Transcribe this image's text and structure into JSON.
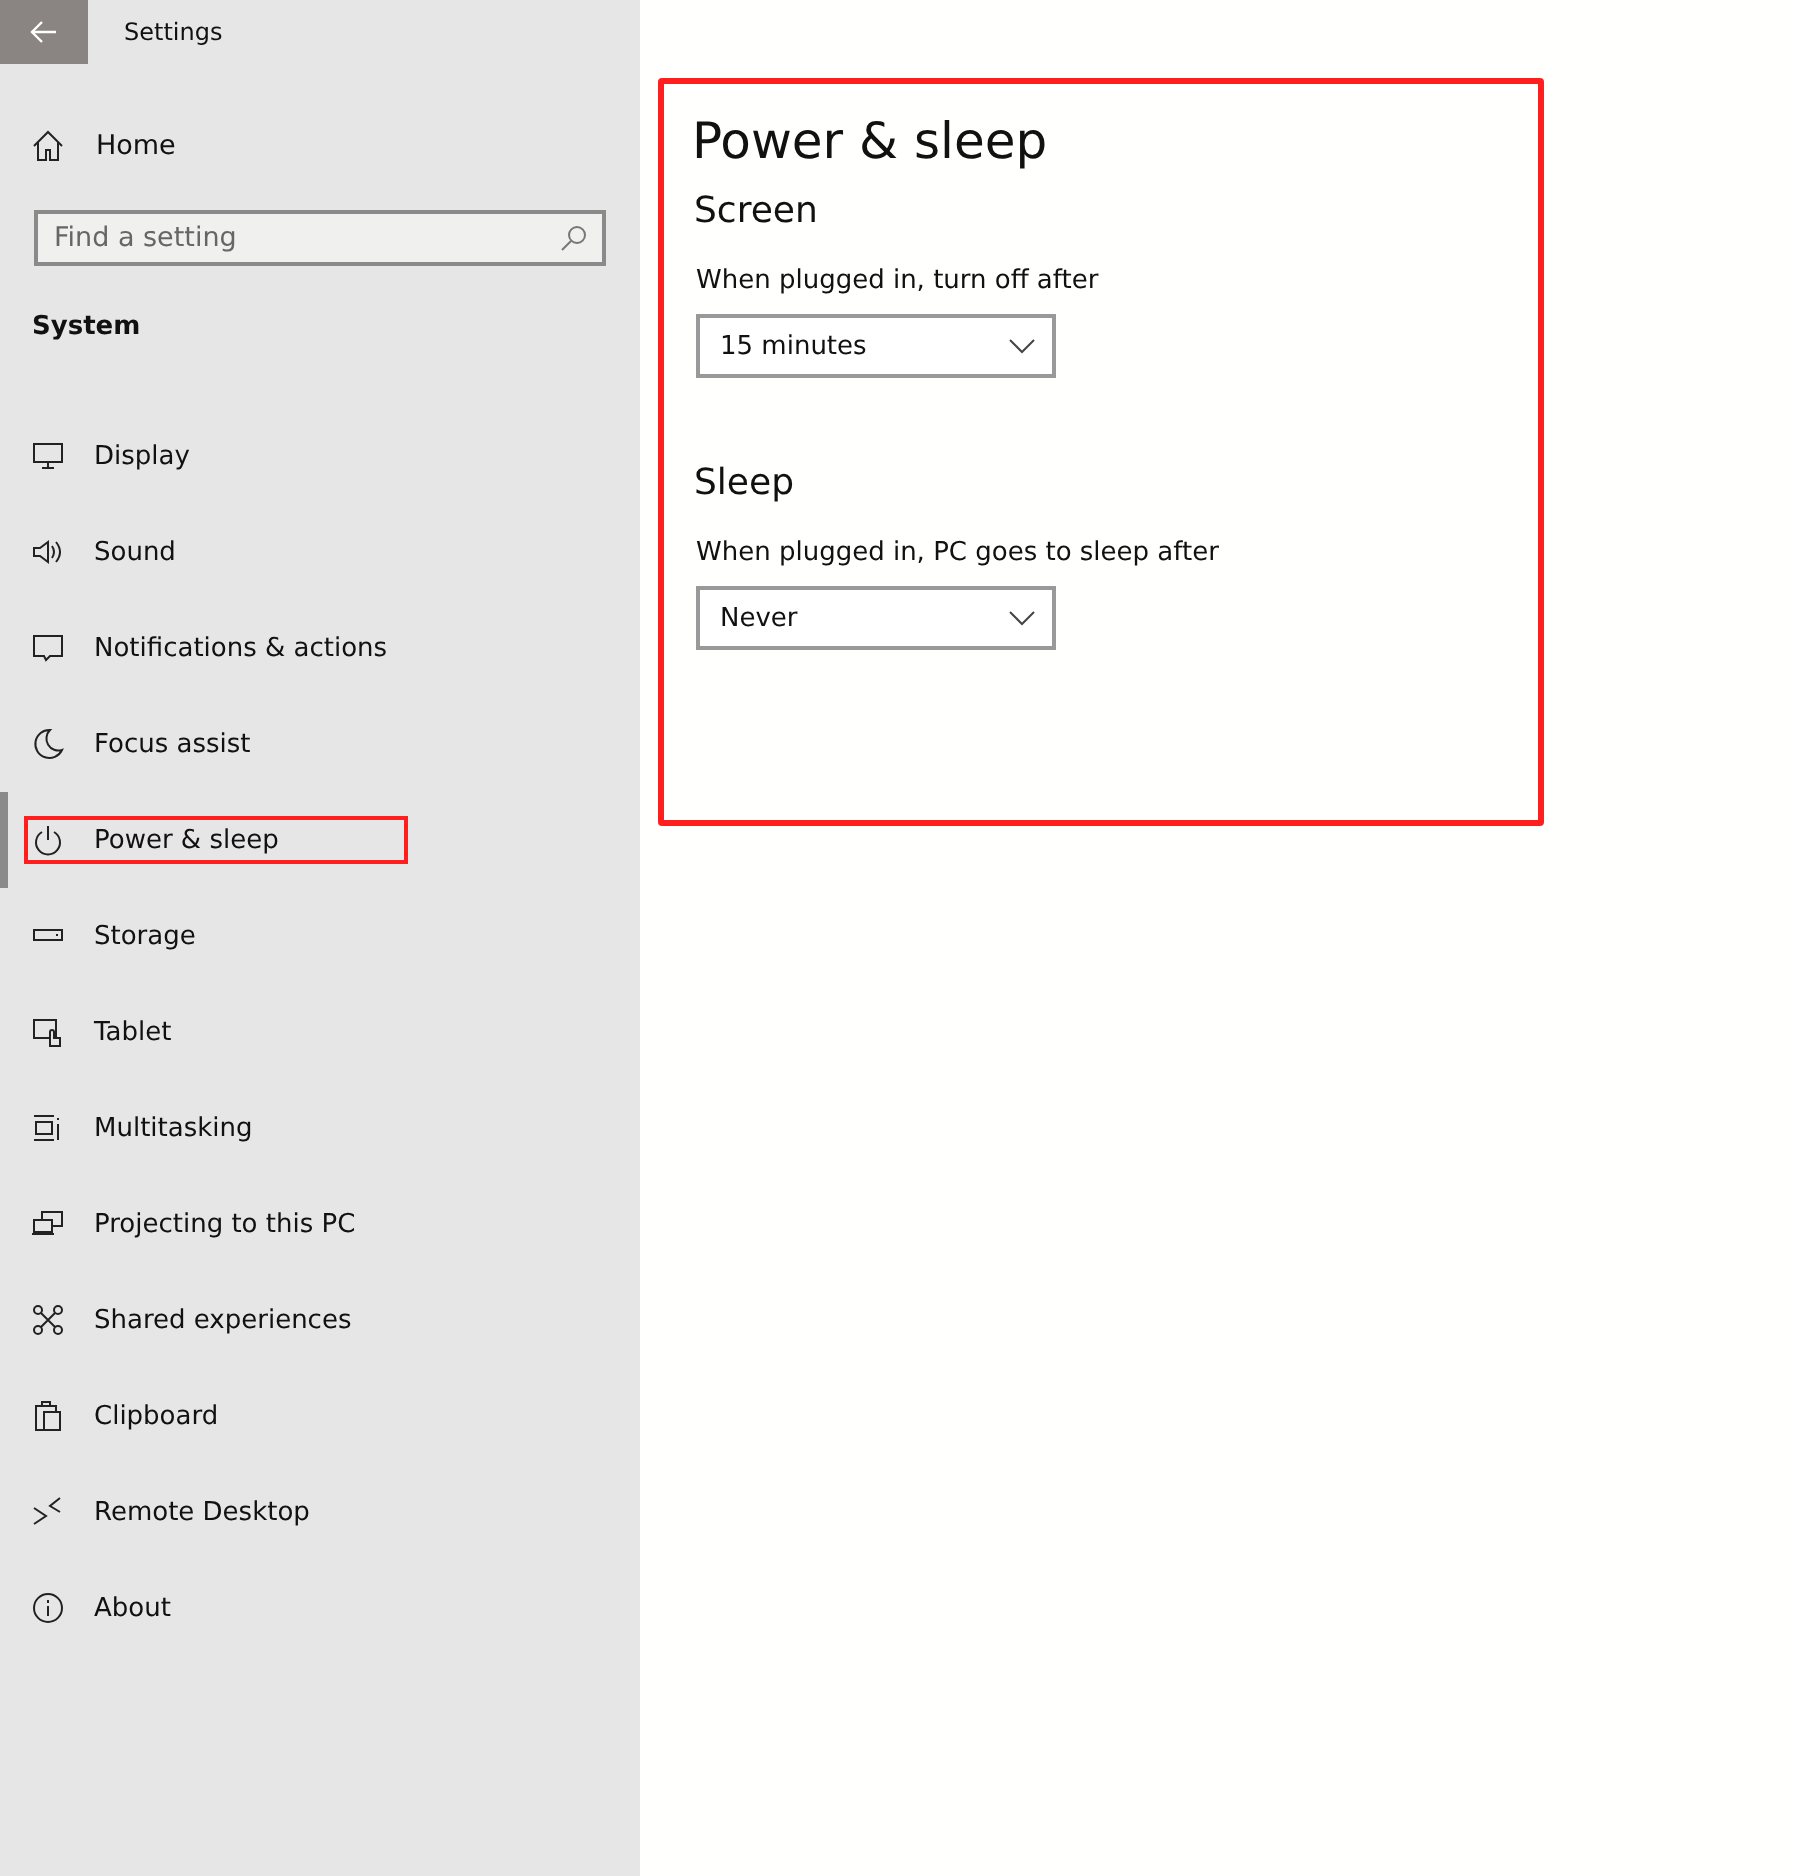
{
  "window": {
    "title": "Settings"
  },
  "sidebar": {
    "home": "Home",
    "search": {
      "placeholder": "Find a setting"
    },
    "section": "System",
    "items": [
      {
        "label": "Display",
        "selected": false,
        "highlighted": false
      },
      {
        "label": "Sound",
        "selected": false,
        "highlighted": false
      },
      {
        "label": "Notifications & actions",
        "selected": false,
        "highlighted": false
      },
      {
        "label": "Focus assist",
        "selected": false,
        "highlighted": false
      },
      {
        "label": "Power & sleep",
        "selected": true,
        "highlighted": true
      },
      {
        "label": "Storage",
        "selected": false,
        "highlighted": false
      },
      {
        "label": "Tablet",
        "selected": false,
        "highlighted": false
      },
      {
        "label": "Multitasking",
        "selected": false,
        "highlighted": false
      },
      {
        "label": "Projecting to this PC",
        "selected": false,
        "highlighted": false
      },
      {
        "label": "Shared experiences",
        "selected": false,
        "highlighted": false
      },
      {
        "label": "Clipboard",
        "selected": false,
        "highlighted": false
      },
      {
        "label": "Remote Desktop",
        "selected": false,
        "highlighted": false
      },
      {
        "label": "About",
        "selected": false,
        "highlighted": false
      }
    ]
  },
  "content": {
    "title": "Power & sleep",
    "highlighted": true,
    "sections": [
      {
        "heading": "Screen",
        "label": "When plugged in, turn off after",
        "value": "15 minutes"
      },
      {
        "heading": "Sleep",
        "label": "When plugged in, PC goes to sleep after",
        "value": "Never"
      }
    ]
  }
}
